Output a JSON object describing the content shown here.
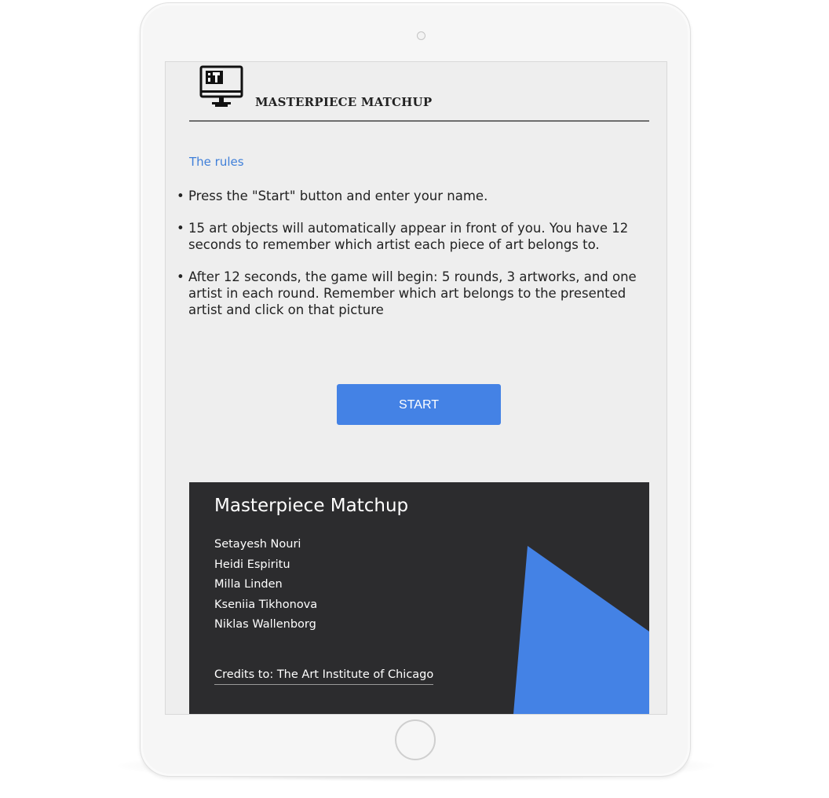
{
  "header": {
    "app_title": "MASTERPIECE MATCHUP",
    "logo_icon": "computer-monitor-art-icon"
  },
  "rules": {
    "heading": "The rules",
    "items": [
      "Press the \"Start\" button and enter your name.",
      "15 art objects will automatically appear in front of you. You have 12 seconds to remember which artist each piece of art belongs to.",
      "After 12 seconds, the game will begin: 5 rounds, 3 artworks, and one artist in each round. Remember which art belongs to the presented artist and click on that picture"
    ],
    "bullet": "•"
  },
  "start_button": {
    "label": "START"
  },
  "footer": {
    "title": "Masterpiece Matchup",
    "names": [
      "Setayesh Nouri",
      "Heidi Espiritu",
      "Milla Linden",
      "Kseniia Tikhonova",
      "Niklas Wallenborg"
    ],
    "credits": "Credits to: The Art Institute of Chicago"
  },
  "colors": {
    "accent": "#4482e5",
    "link": "#3f7fd9",
    "footer_bg": "#2c2c2e",
    "screen_bg": "#eeeeee",
    "device_frame": "#f6f6f6"
  }
}
